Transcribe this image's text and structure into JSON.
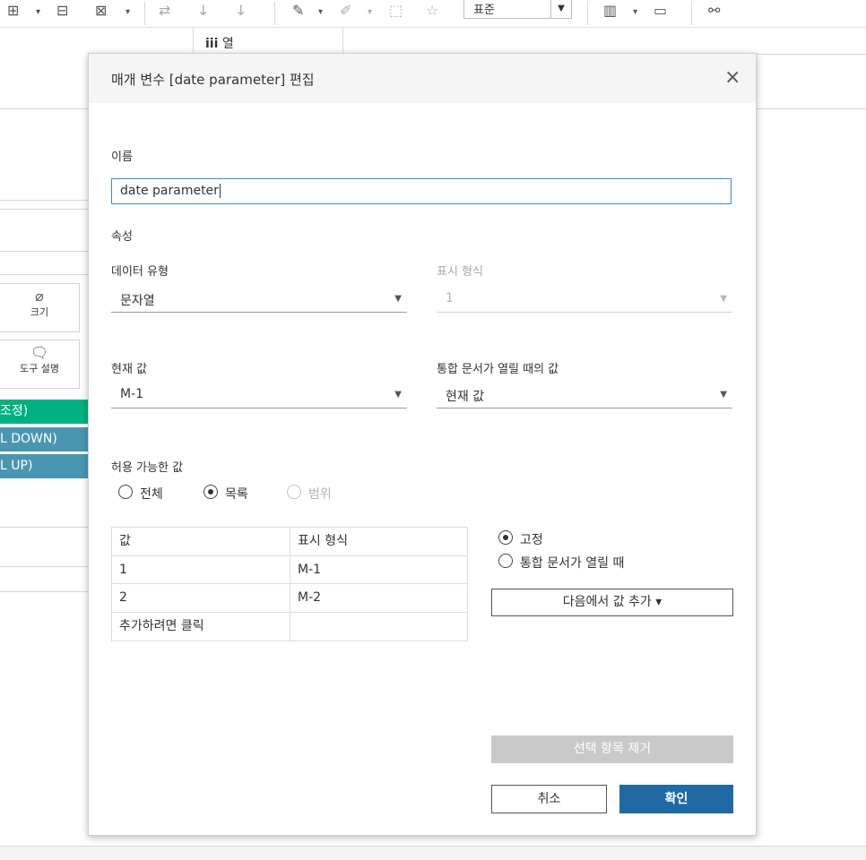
{
  "toolbar": {
    "style_select_value": "표준",
    "icons": [
      "add-sheet-icon",
      "duplicate-sheet-icon",
      "clear-sheet-icon",
      "swap-icon",
      "sort-ascending-icon",
      "sort-descending-icon",
      "highlight-icon",
      "annotate-icon",
      "fit-icon",
      "pin-icon",
      "show-me-icon",
      "presentation-icon",
      "share-icon"
    ]
  },
  "columns_shelf": {
    "icon": "iii",
    "label": "열"
  },
  "marks_cards": {
    "size_label": "크기",
    "tooltip_label": "도구 설명"
  },
  "pills": [
    {
      "label": "조정)",
      "color": "#00b180"
    },
    {
      "label": "L DOWN)",
      "color": "#4996b2"
    },
    {
      "label": "L UP)",
      "color": "#4996b2"
    }
  ],
  "dialog": {
    "title": "매개 변수 [date parameter] 편집",
    "close_symbol": "×",
    "name_label": "이름",
    "name_value": "date parameter",
    "properties_label": "속성",
    "data_type_label": "데이터 유형",
    "data_type_value": "문자열",
    "display_format_label": "표시 형식",
    "display_format_value": "1",
    "current_value_label": "현재 값",
    "current_value": "M-1",
    "on_open_label": "통합 문서가 열릴 때의 값",
    "on_open_value": "현재 값",
    "allowable_label": "허용 가능한 값",
    "allowable_options": {
      "all": "전체",
      "list": "목록",
      "range": "범위"
    },
    "table": {
      "headers": [
        "값",
        "표시 형식"
      ],
      "rows": [
        [
          "1",
          "M-1"
        ],
        [
          "2",
          "M-2"
        ],
        [
          "추가하려면 클릭",
          ""
        ]
      ]
    },
    "list_source": {
      "fixed": "고정",
      "on_open": "통합 문서가 열릴 때"
    },
    "add_from_button": "다음에서 값 추가 ▾",
    "remove_selected_button": "선택 항목 제거",
    "cancel_button": "취소",
    "ok_button": "확인",
    "colors": {
      "primary": "#1f6aa5",
      "focus_border": "#3b8bd4"
    }
  }
}
